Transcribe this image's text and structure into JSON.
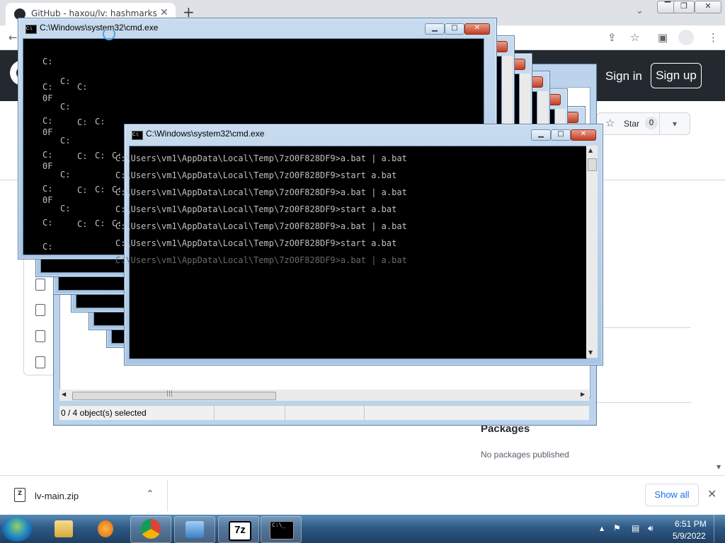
{
  "browser": {
    "tab_title": "GitHub - haxou/lv: hashmarks",
    "tab_close": "✕",
    "new_tab": "+",
    "window_controls": [
      "▔",
      "❐",
      "✕"
    ],
    "collapse_tabs": "⌄"
  },
  "github": {
    "signin": "Sign in",
    "signup": "Sign up",
    "star_label": "Star",
    "star_count": "0",
    "star_caret": "▾",
    "packages_title": "Packages",
    "packages_empty": "No packages published"
  },
  "downloads": {
    "file_name": "lv-main.zip",
    "zip_glyph": "Z",
    "show_all": "Show all",
    "caret": "⌃",
    "close": "✕"
  },
  "explorer": {
    "status": "0 / 4 object(s) selected",
    "thumb_grip": "|||"
  },
  "cmd": {
    "title": "C:\\Windows\\system32\\cmd.exe",
    "line_a": "C:\\Users\\vm1\\AppData\\Local\\Temp\\7zO0F828DF9>a.bat | a.bat",
    "line_b": "C:\\Users\\vm1\\AppData\\Local\\Temp\\7zO0F828DF9>start a.bat",
    "stub_c": "C:",
    "stub_0f": "0F",
    "min": "▁",
    "max": "□",
    "close": "✕",
    "icon": "C:\\"
  },
  "taskbar": {
    "time": "6:51 PM",
    "date": "5/9/2022",
    "sevenzip": "7z",
    "cmd_glyph": "C:\\_",
    "tray_up": "▲"
  }
}
